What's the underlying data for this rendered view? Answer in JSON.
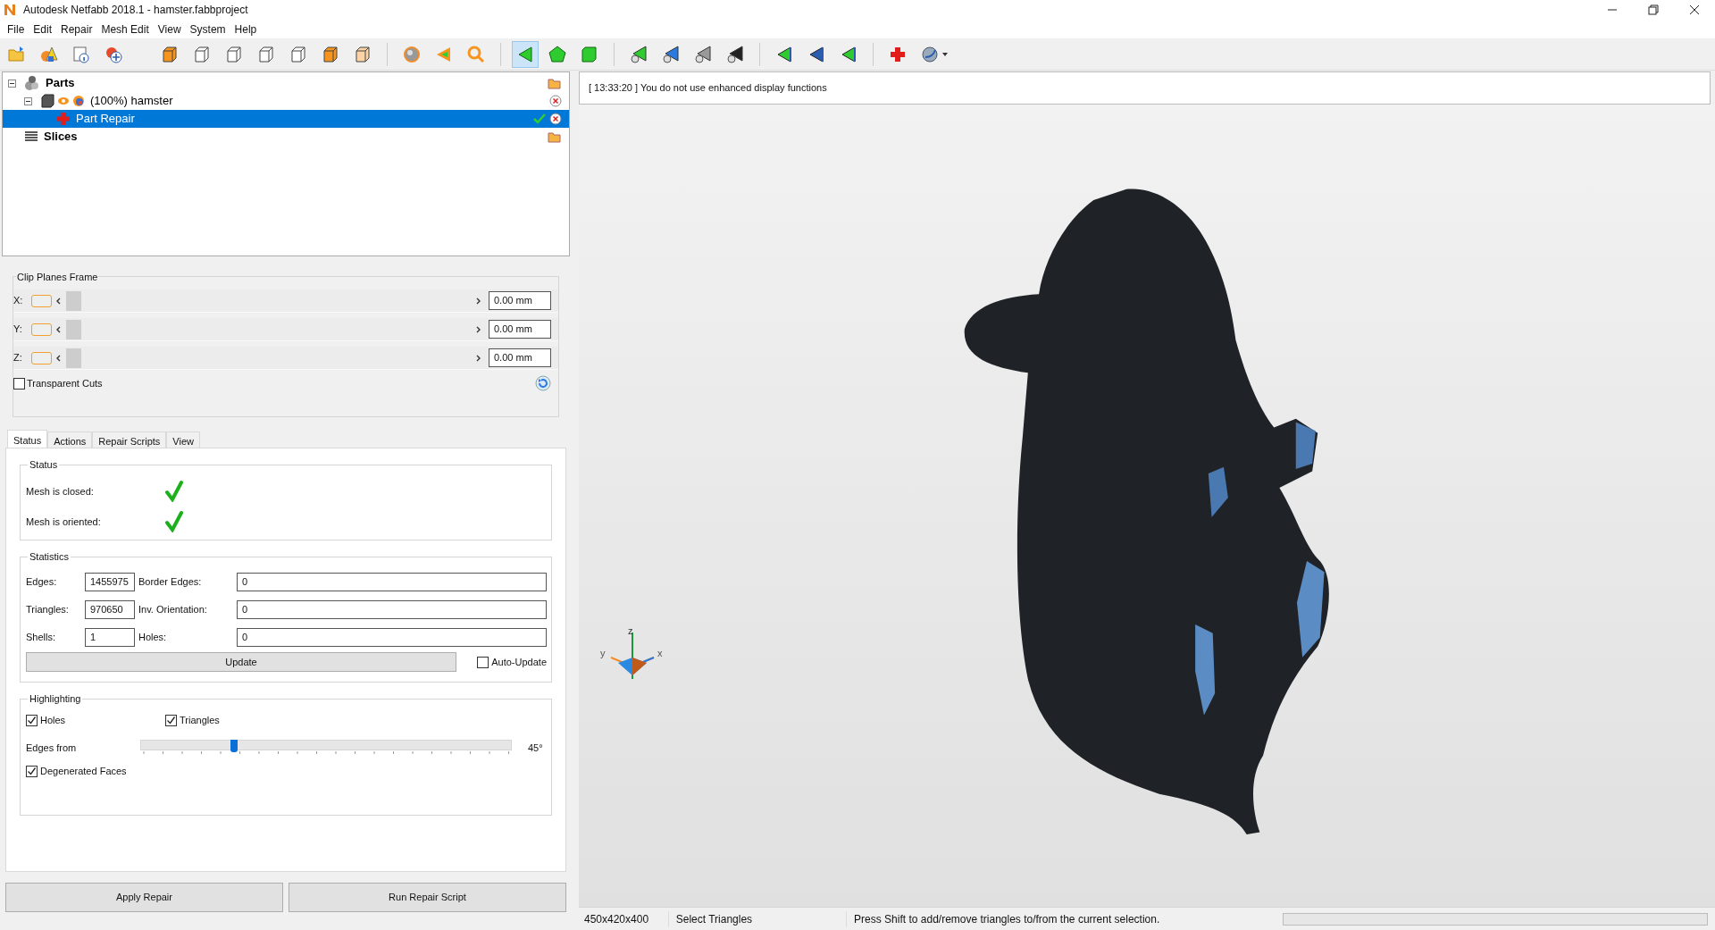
{
  "window": {
    "title": "Autodesk Netfabb 2018.1 - hamster.fabbproject"
  },
  "menu": [
    "File",
    "Edit",
    "Repair",
    "Mesh Edit",
    "View",
    "System",
    "Help"
  ],
  "toolbar": [
    {
      "selected": false
    },
    {
      "selected": false
    },
    {
      "selected": false
    },
    {
      "selected": false
    },
    {
      "selected": false
    },
    {
      "selected": false
    },
    {
      "selected": false
    },
    {
      "selected": false
    },
    {
      "selected": false
    },
    {
      "selected": false
    },
    {
      "selected": false
    },
    {
      "selected": false
    },
    {
      "selected": false
    },
    {
      "selected": false
    },
    {
      "selected": true
    },
    {
      "selected": false
    },
    {
      "selected": false
    },
    {
      "selected": false
    },
    {
      "selected": false
    },
    {
      "selected": false
    },
    {
      "selected": false
    },
    {
      "selected": false
    },
    {
      "selected": false
    },
    {
      "selected": false
    },
    {
      "selected": false
    },
    {
      "selected": false
    }
  ],
  "tree": [
    {
      "label": "Parts",
      "kind": "group",
      "selected": false,
      "expanded": true,
      "children": [
        {
          "label": "(100%) hamster",
          "kind": "part",
          "selected": false,
          "expanded": true,
          "children": [
            {
              "label": "Part Repair",
              "kind": "repair",
              "selected": true
            }
          ]
        }
      ]
    },
    {
      "label": "Slices",
      "kind": "slices",
      "selected": false
    }
  ],
  "clip_planes": {
    "title": "Clip Planes Frame",
    "axes": [
      {
        "label": "X:",
        "level": 0,
        "value": "0.00 mm"
      },
      {
        "label": "Y:",
        "level": 0,
        "value": "0.00 mm"
      },
      {
        "label": "Z:",
        "level": 0,
        "value": "0.00 mm"
      }
    ],
    "transparent_cuts": {
      "label": "Transparent Cuts",
      "checked": false
    }
  },
  "tabs": [
    {
      "label": "Status",
      "selected": true
    },
    {
      "label": "Actions",
      "selected": false
    },
    {
      "label": "Repair Scripts",
      "selected": false
    },
    {
      "label": "View",
      "selected": false
    }
  ],
  "status": {
    "title": "Status",
    "items": [
      {
        "label": "Mesh is closed:",
        "ok": true
      },
      {
        "label": "Mesh is oriented:",
        "ok": true
      }
    ]
  },
  "statistics": {
    "title": "Statistics",
    "rows": [
      {
        "label": "Edges:",
        "value": "1455975",
        "label2": "Border Edges:",
        "value2": "0"
      },
      {
        "label": "Triangles:",
        "value": "970650",
        "label2": "Inv. Orientation:",
        "value2": "0"
      },
      {
        "label": "Shells:",
        "value": "1",
        "label2": "Holes:",
        "value2": "0"
      }
    ],
    "update": "Update",
    "auto_update": {
      "label": "Auto-Update",
      "checked": false
    }
  },
  "highlighting": {
    "title": "Highlighting",
    "holes": {
      "label": "Holes",
      "checked": true
    },
    "triangles": {
      "label": "Triangles",
      "checked": true
    },
    "edges": {
      "label": "Edges from",
      "level": 0.25,
      "reading": "45°"
    },
    "degenerated": {
      "label": "Degenerated Faces",
      "checked": true
    }
  },
  "buttons": [
    "Apply Repair",
    "Run Repair Script"
  ],
  "log": "[ 13:33:20 ] You do not use enhanced display functions",
  "axes": {
    "z": "z",
    "y": "y",
    "x": "x"
  },
  "status_bar": {
    "size": "450x420x400",
    "mode": "Select Triangles",
    "hint": "Press Shift to add/remove triangles to/from the current selection.",
    "progress": {
      "level": 0
    }
  }
}
